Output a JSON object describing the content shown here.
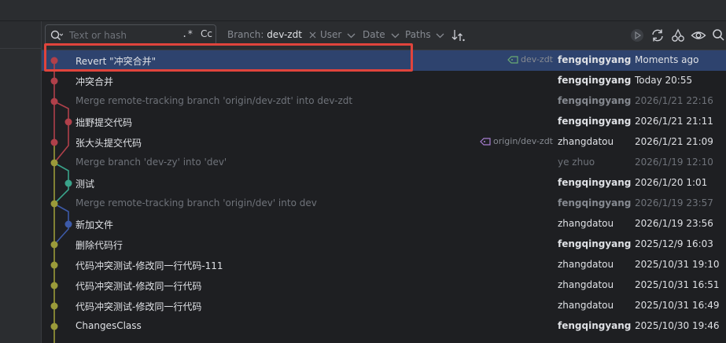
{
  "colors": {
    "accent_selected": "#2e436e",
    "highlight_box": "#e0443c",
    "branch_red": "#b0404a",
    "branch_olive": "#9a9a3a",
    "branch_teal": "#3aa38a",
    "branch_blue": "#3d5aa8",
    "tag_green": "#6aab73",
    "tag_purple": "#a77ed1"
  },
  "toolbar": {
    "search_placeholder": "Text or hash",
    "search_icon": "search-icon",
    "regex_label": ".*",
    "case_label": "Cc",
    "branch_filter": {
      "label": "Branch: ",
      "value": "dev-zdt"
    },
    "user_filter": "User",
    "date_filter": "Date",
    "paths_filter": "Paths",
    "icons": [
      "sort-icon",
      "play-icon",
      "refresh-icon",
      "cherry-pick-icon",
      "eye-icon",
      "search-icon"
    ]
  },
  "commits": [
    {
      "subject": "Revert \"冲突合并\"",
      "ref": "dev-zdt",
      "ref_type": "tag-local",
      "author": "fengqingyang",
      "author_bold": true,
      "date": "Moments ago",
      "merge": false,
      "selected": true
    },
    {
      "subject": "冲突合并",
      "ref": "",
      "author": "fengqingyang",
      "author_bold": true,
      "date": "Today 20:55",
      "merge": false
    },
    {
      "subject": "Merge remote-tracking branch 'origin/dev-zdt' into dev-zdt",
      "ref": "",
      "author": "fengqingyang",
      "author_bold": true,
      "date": "2026/1/21 22:16",
      "merge": true
    },
    {
      "subject": "拙野提交代码",
      "ref": "",
      "author": "fengqingyang",
      "author_bold": true,
      "date": "2026/1/21 21:11",
      "merge": false
    },
    {
      "subject": "张大头提交代码",
      "ref": "origin/dev-zdt",
      "ref_type": "tag-remote",
      "author": "zhangdatou",
      "author_bold": false,
      "date": "2026/1/21 21:09",
      "merge": false
    },
    {
      "subject": "Merge branch 'dev-zy' into 'dev'",
      "ref": "",
      "author": "ye zhuo",
      "author_bold": false,
      "date": "2026/1/19 12:10",
      "merge": true
    },
    {
      "subject": "测试",
      "ref": "",
      "author": "fengqingyang",
      "author_bold": true,
      "date": "2026/1/20 1:01",
      "merge": false
    },
    {
      "subject": "Merge remote-tracking branch 'origin/dev' into dev",
      "ref": "",
      "author": "fengqingyang",
      "author_bold": true,
      "date": "2026/1/19 23:57",
      "merge": true
    },
    {
      "subject": "新加文件",
      "ref": "",
      "author": "zhangdatou",
      "author_bold": false,
      "date": "2026/1/19 23:56",
      "merge": false
    },
    {
      "subject": "删除代码行",
      "ref": "",
      "author": "fengqingyang",
      "author_bold": true,
      "date": "2025/12/9 16:03",
      "merge": false
    },
    {
      "subject": "代码冲突测试-修改同一行代码-111",
      "ref": "",
      "author": "zhangdatou",
      "author_bold": false,
      "date": "2025/10/31 19:10",
      "merge": false
    },
    {
      "subject": "代码冲突测试-修改同一行代码",
      "ref": "",
      "author": "zhangdatou",
      "author_bold": false,
      "date": "2025/10/31 16:51",
      "merge": false
    },
    {
      "subject": "代码冲突测试-修改同一行代码",
      "ref": "",
      "author": "zhangdatou",
      "author_bold": false,
      "date": "2025/10/31 16:49",
      "merge": false
    },
    {
      "subject": "ChangesClass",
      "ref": "",
      "author": "fengqingyang",
      "author_bold": true,
      "date": "2025/10/30 19:46",
      "merge": false
    }
  ]
}
